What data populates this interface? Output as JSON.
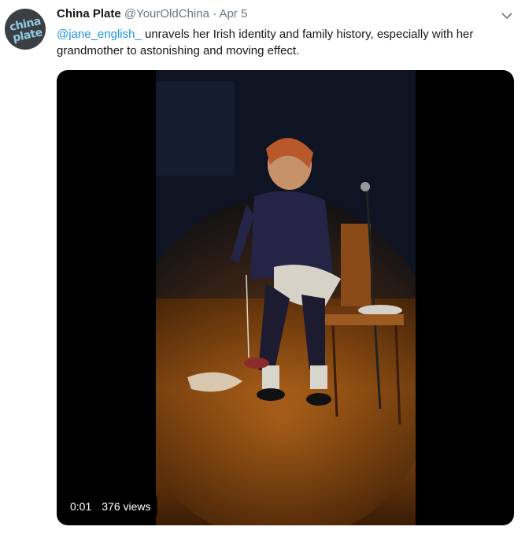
{
  "tweet": {
    "author_name": "China Plate",
    "author_handle": "@YourOldChina",
    "separator": "·",
    "date": "Apr 5",
    "avatar": {
      "line1": "china",
      "line2": "plate"
    },
    "mention": "@jane_english_",
    "body": " unravels her Irish identity and family history, especially with her grandmother to astonishing and moving effect."
  },
  "video": {
    "time": "0:01",
    "views": "376 views"
  },
  "icons": {
    "menu": "chevron-down-icon"
  },
  "colors": {
    "link": "#1b95e0",
    "muted": "#657786",
    "avatar_text": "#8fcde6"
  }
}
